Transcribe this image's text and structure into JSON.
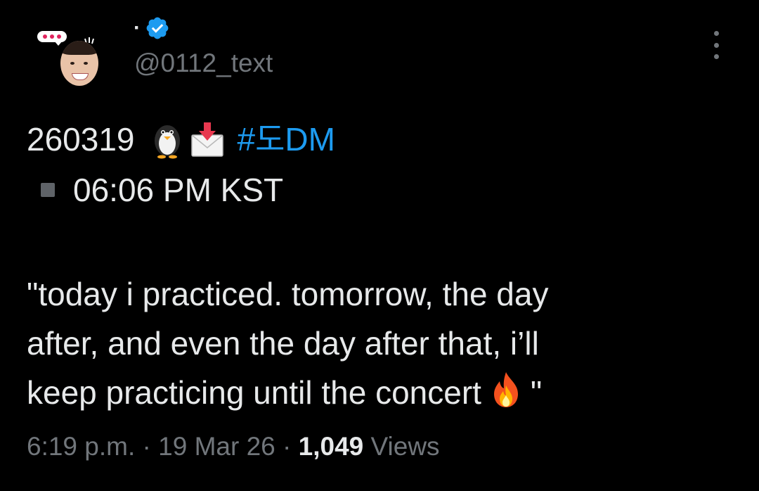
{
  "tweet": {
    "display_name": "·",
    "handle": "@0112_text",
    "avatar_icon": "profile-avatar",
    "verified_icon": "verified-badge-icon",
    "verified_color": "#1d9bf0",
    "more_icon": "more-options-icon",
    "line1_date": "260319",
    "line1_emojis": [
      "penguin-emoji",
      "incoming-envelope-emoji"
    ],
    "hashtag": "#도DM",
    "line2_icon": "black-small-square-icon",
    "line2_time": "06:06 PM KST",
    "quote_lines": [
      "\"today i practiced. tomorrow, the day",
      "after, and even the day after that, i’ll",
      "keep practicing until the concert"
    ],
    "quote_end": "\"",
    "fire_emoji": "fire-emoji",
    "meta_time": "6:19 p.m.",
    "meta_sep": " · ",
    "meta_date": "19 Mar 26",
    "views_count": "1,049",
    "views_label": " Views"
  },
  "colors": {
    "background": "#000000",
    "text_primary": "#e7e9ea",
    "text_secondary": "#71767b",
    "link": "#1d9bf0"
  }
}
